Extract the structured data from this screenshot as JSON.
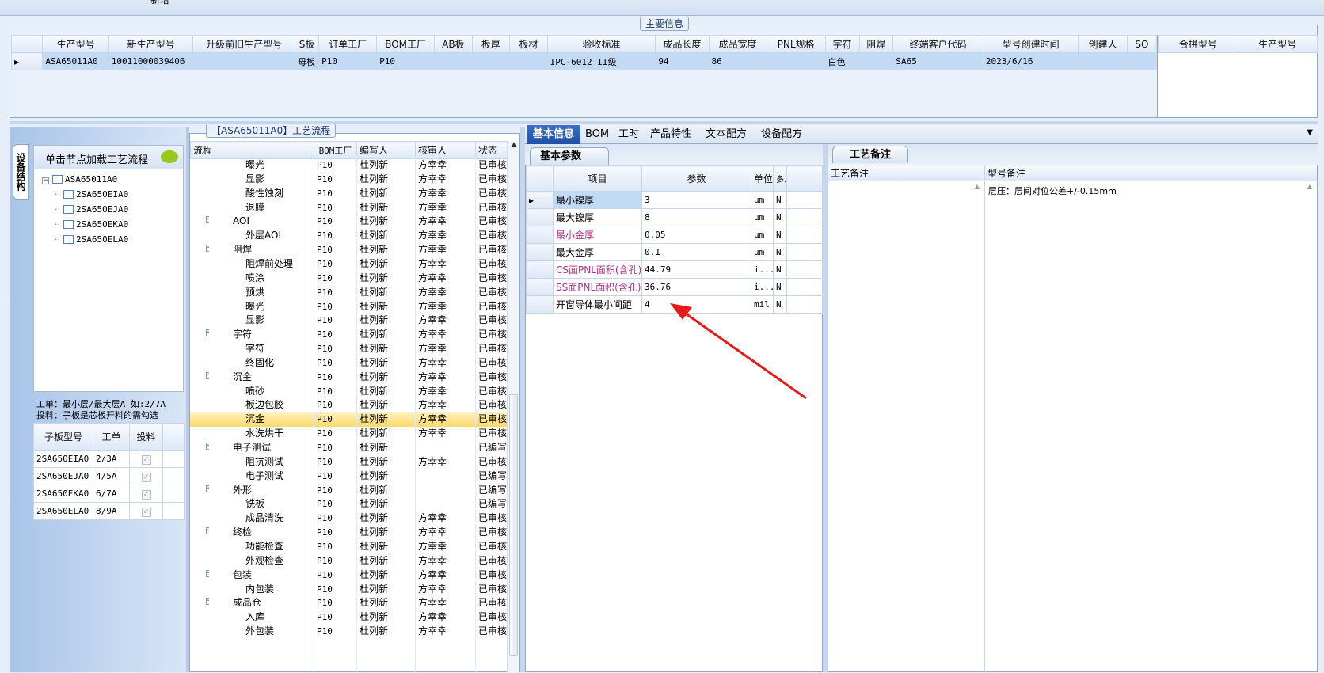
{
  "top_stub": "新增",
  "main_info": {
    "title": "主要信息",
    "columns": [
      "生产型号",
      "新生产型号",
      "升级前旧生产型号",
      "S板",
      "订单工厂",
      "BOM工厂",
      "AB板",
      "板厚",
      "板材",
      "验收标准",
      "成品长度",
      "成品宽度",
      "PNL规格",
      "字符",
      "阻焊",
      "终端客户代码",
      "型号创建时间",
      "创建人",
      "SO"
    ],
    "row": [
      "ASA65011A0",
      "10011000039406",
      "",
      "母板",
      "P10",
      "P10",
      "",
      "",
      "",
      "IPC-6012 II级",
      "94",
      "86",
      "",
      "白色",
      "",
      "SA65",
      "2023/6/16",
      "",
      ""
    ],
    "right_columns": [
      "合拼型号",
      "生产型号"
    ]
  },
  "left_panel": {
    "vertical_tab": "设备结构",
    "hint": "单击节点加载工艺流程",
    "tree_root": "ASA65011A0",
    "tree_children": [
      "2SA650EIA0",
      "2SA650EJA0",
      "2SA650EKA0",
      "2SA650ELA0"
    ],
    "note_line1": "工单：最小层/最大层A 如:2/7A",
    "note_line2": "投料：子板是芯板开料的需勾选",
    "sub_columns": [
      "子板型号",
      "工单",
      "投料"
    ],
    "sub_rows": [
      [
        "2SA650EIA0",
        "2/3A",
        "✓"
      ],
      [
        "2SA650EJA0",
        "4/5A",
        "✓"
      ],
      [
        "2SA650EKA0",
        "6/7A",
        "✓"
      ],
      [
        "2SA650ELA0",
        "8/9A",
        "✓"
      ]
    ]
  },
  "process": {
    "title": "【ASA65011A0】工艺流程",
    "columns": [
      "流程",
      "BOM工厂",
      "编写人",
      "核审人",
      "状态"
    ],
    "rows": [
      {
        "level": 2,
        "name": "曝光",
        "bom": "P10",
        "writer": "杜列新",
        "reviewer": "方幸幸",
        "status": "已审核"
      },
      {
        "level": 2,
        "name": "显影",
        "bom": "P10",
        "writer": "杜列新",
        "reviewer": "方幸幸",
        "status": "已审核"
      },
      {
        "level": 2,
        "name": "酸性蚀刻",
        "bom": "P10",
        "writer": "杜列新",
        "reviewer": "方幸幸",
        "status": "已审核"
      },
      {
        "level": 2,
        "name": "退膜",
        "bom": "P10",
        "writer": "杜列新",
        "reviewer": "方幸幸",
        "status": "已审核"
      },
      {
        "level": 1,
        "name": "AOI",
        "bom": "P10",
        "writer": "杜列新",
        "reviewer": "方幸幸",
        "status": "已审核"
      },
      {
        "level": 2,
        "name": "外层AOI",
        "bom": "P10",
        "writer": "杜列新",
        "reviewer": "方幸幸",
        "status": "已审核"
      },
      {
        "level": 1,
        "name": "阻焊",
        "bom": "P10",
        "writer": "杜列新",
        "reviewer": "方幸幸",
        "status": "已审核"
      },
      {
        "level": 2,
        "name": "阻焊前处理",
        "bom": "P10",
        "writer": "杜列新",
        "reviewer": "方幸幸",
        "status": "已审核"
      },
      {
        "level": 2,
        "name": "喷涂",
        "bom": "P10",
        "writer": "杜列新",
        "reviewer": "方幸幸",
        "status": "已审核"
      },
      {
        "level": 2,
        "name": "预烘",
        "bom": "P10",
        "writer": "杜列新",
        "reviewer": "方幸幸",
        "status": "已审核"
      },
      {
        "level": 2,
        "name": "曝光",
        "bom": "P10",
        "writer": "杜列新",
        "reviewer": "方幸幸",
        "status": "已审核"
      },
      {
        "level": 2,
        "name": "显影",
        "bom": "P10",
        "writer": "杜列新",
        "reviewer": "方幸幸",
        "status": "已审核"
      },
      {
        "level": 1,
        "name": "字符",
        "bom": "P10",
        "writer": "杜列新",
        "reviewer": "方幸幸",
        "status": "已审核"
      },
      {
        "level": 2,
        "name": "字符",
        "bom": "P10",
        "writer": "杜列新",
        "reviewer": "方幸幸",
        "status": "已审核"
      },
      {
        "level": 2,
        "name": "终固化",
        "bom": "P10",
        "writer": "杜列新",
        "reviewer": "方幸幸",
        "status": "已审核"
      },
      {
        "level": 1,
        "name": "沉金",
        "bom": "P10",
        "writer": "杜列新",
        "reviewer": "方幸幸",
        "status": "已审核"
      },
      {
        "level": 2,
        "name": "喷砂",
        "bom": "P10",
        "writer": "杜列新",
        "reviewer": "方幸幸",
        "status": "已审核"
      },
      {
        "level": 2,
        "name": "板边包胶",
        "bom": "P10",
        "writer": "杜列新",
        "reviewer": "方幸幸",
        "status": "已审核"
      },
      {
        "level": 2,
        "name": "沉金",
        "bom": "P10",
        "writer": "杜列新",
        "reviewer": "方幸幸",
        "status": "已审核",
        "selected": true
      },
      {
        "level": 2,
        "name": "水洗烘干",
        "bom": "P10",
        "writer": "杜列新",
        "reviewer": "方幸幸",
        "status": "已审核"
      },
      {
        "level": 1,
        "name": "电子测试",
        "bom": "P10",
        "writer": "杜列新",
        "reviewer": "",
        "status": "已编写"
      },
      {
        "level": 2,
        "name": "阻抗测试",
        "bom": "P10",
        "writer": "杜列新",
        "reviewer": "方幸幸",
        "status": "已审核"
      },
      {
        "level": 2,
        "name": "电子测试",
        "bom": "P10",
        "writer": "杜列新",
        "reviewer": "",
        "status": "已编写"
      },
      {
        "level": 1,
        "name": "外形",
        "bom": "P10",
        "writer": "杜列新",
        "reviewer": "",
        "status": "已编写"
      },
      {
        "level": 2,
        "name": "铣板",
        "bom": "P10",
        "writer": "杜列新",
        "reviewer": "",
        "status": "已编写"
      },
      {
        "level": 2,
        "name": "成品清洗",
        "bom": "P10",
        "writer": "杜列新",
        "reviewer": "方幸幸",
        "status": "已审核"
      },
      {
        "level": 1,
        "name": "终检",
        "bom": "P10",
        "writer": "杜列新",
        "reviewer": "方幸幸",
        "status": "已审核"
      },
      {
        "level": 2,
        "name": "功能检查",
        "bom": "P10",
        "writer": "杜列新",
        "reviewer": "方幸幸",
        "status": "已审核"
      },
      {
        "level": 2,
        "name": "外观检查",
        "bom": "P10",
        "writer": "杜列新",
        "reviewer": "方幸幸",
        "status": "已审核"
      },
      {
        "level": 1,
        "name": "包装",
        "bom": "P10",
        "writer": "杜列新",
        "reviewer": "方幸幸",
        "status": "已审核"
      },
      {
        "level": 2,
        "name": "内包装",
        "bom": "P10",
        "writer": "杜列新",
        "reviewer": "方幸幸",
        "status": "已审核"
      },
      {
        "level": 1,
        "name": "成品仓",
        "bom": "P10",
        "writer": "杜列新",
        "reviewer": "方幸幸",
        "status": "已审核"
      },
      {
        "level": 2,
        "name": "入库",
        "bom": "P10",
        "writer": "杜列新",
        "reviewer": "方幸幸",
        "status": "已审核"
      },
      {
        "level": 2,
        "name": "外包装",
        "bom": "P10",
        "writer": "杜列新",
        "reviewer": "方幸幸",
        "status": "已审核"
      }
    ]
  },
  "tabs": [
    "基本信息",
    "BOM",
    "工时",
    "产品特性",
    "文本配方",
    "设备配方"
  ],
  "basic": {
    "subtab": "基本参数",
    "columns": [
      "项目",
      "参数",
      "单位",
      "多."
    ],
    "rows": [
      {
        "item": "最小镍厚",
        "value": "3",
        "unit": "μm",
        "multi": "N",
        "color": "#000000"
      },
      {
        "item": "最大镍厚",
        "value": "8",
        "unit": "μm",
        "multi": "N",
        "color": "#000000"
      },
      {
        "item": "最小金厚",
        "value": "0.05",
        "unit": "μm",
        "multi": "N",
        "color": "#b0308a"
      },
      {
        "item": "最大金厚",
        "value": "0.1",
        "unit": "μm",
        "multi": "N",
        "color": "#000000"
      },
      {
        "item": "CS面PNL面积(含孔)",
        "value": "44.79",
        "unit": "i...",
        "multi": "N",
        "color": "#b0308a"
      },
      {
        "item": "SS面PNL面积(含孔)",
        "value": "36.76",
        "unit": "i...",
        "multi": "N",
        "color": "#b0308a"
      },
      {
        "item": "开窗导体最小间距",
        "value": "4",
        "unit": "mil",
        "multi": "N",
        "color": "#000000"
      }
    ]
  },
  "remark": {
    "subtab": "工艺备注",
    "col1": "工艺备注",
    "col2": "型号备注",
    "model_note": "层压：层间对位公差+/-0.15mm"
  },
  "annotation_color": "#e31b1b"
}
